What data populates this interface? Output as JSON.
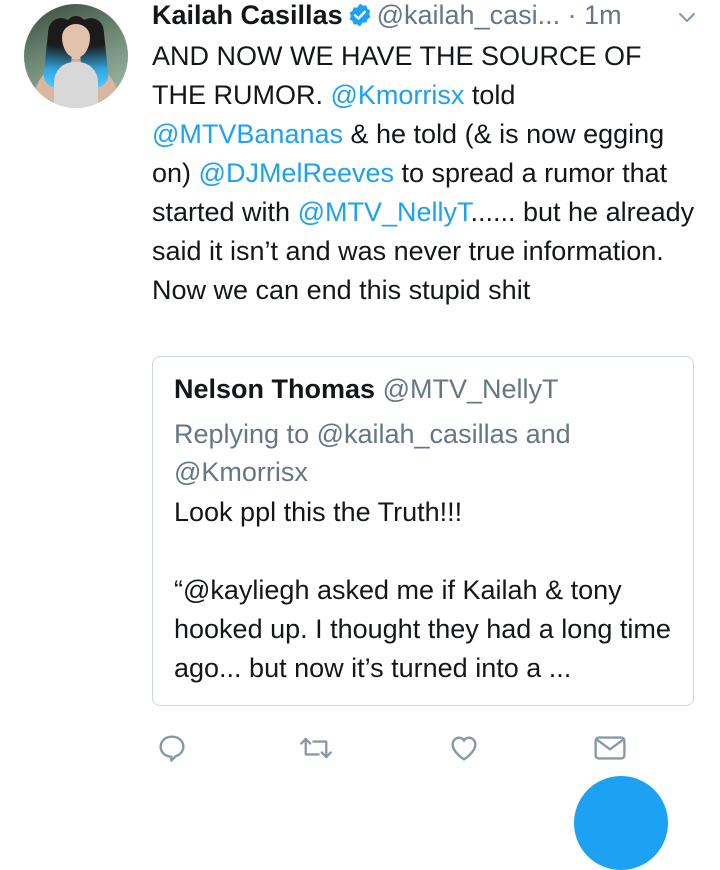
{
  "author": {
    "name": "Kailah Casillas",
    "handle": "@kailah_casi...",
    "dot": "·",
    "time": "1m"
  },
  "tweet": {
    "segments": [
      {
        "t": "AND NOW WE HAVE THE SOURCE OF THE RUMOR. ",
        "m": false
      },
      {
        "t": "@Kmorrisx",
        "m": true
      },
      {
        "t": " told ",
        "m": false
      },
      {
        "t": "@MTVBananas",
        "m": true
      },
      {
        "t": " & he told (& is now egging on) ",
        "m": false
      },
      {
        "t": "@DJMelReeves",
        "m": true
      },
      {
        "t": " to spread a rumor that started with ",
        "m": false
      },
      {
        "t": "@MTV_NellyT",
        "m": true
      },
      {
        "t": "...... but he already said it isn’t and was never true information. Now we can end this stupid shit",
        "m": false
      }
    ]
  },
  "quote": {
    "name": "Nelson Thomas",
    "handle": "@MTV_NellyT",
    "replying": "Replying to @kailah_casillas and @Kmorrisx",
    "line1": "Look ppl this the Truth!!!",
    "line2": "“@kayliegh asked me if Kailah & tony hooked up. I thought they had a long time ago... but now it’s turned into a ..."
  },
  "actions": {
    "reply": "reply-icon",
    "retweet": "retweet-icon",
    "like": "heart-icon",
    "message": "mail-icon"
  },
  "colors": {
    "link": "#1da1f2",
    "secondary": "#657786",
    "border": "#ccd6dd"
  }
}
